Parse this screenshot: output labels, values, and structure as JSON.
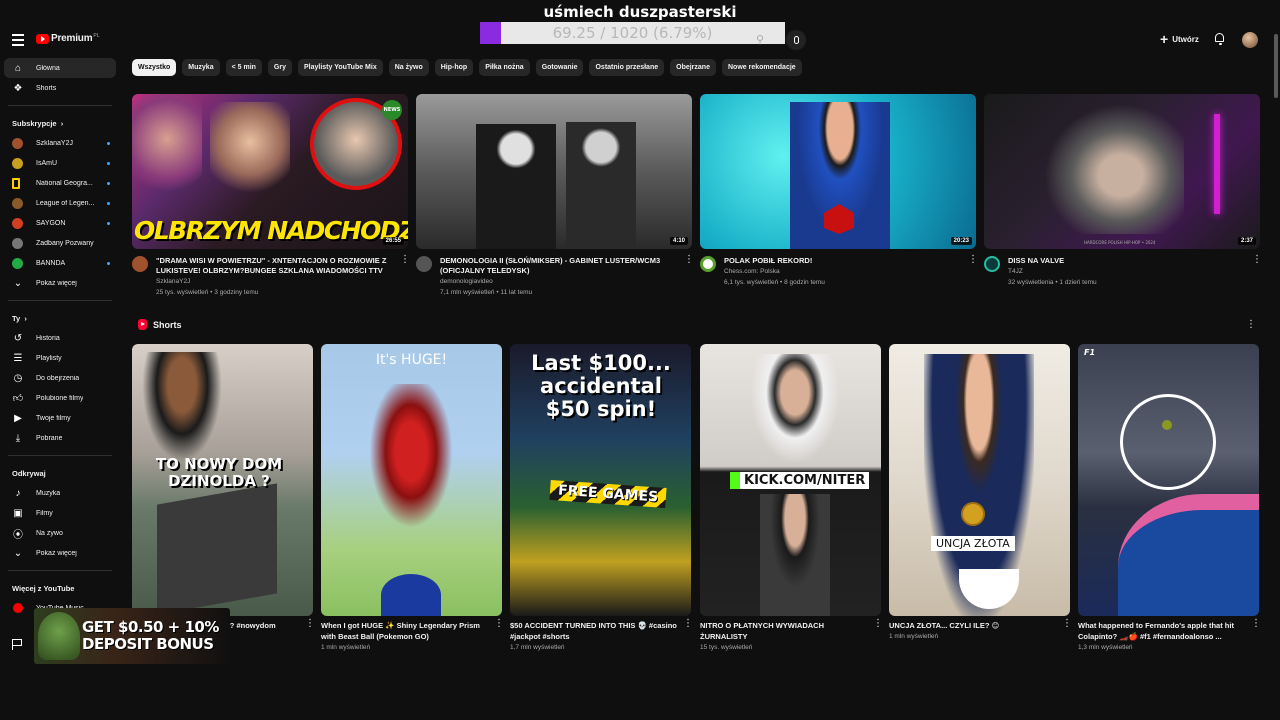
{
  "overlay": {
    "title": "uśmiech duszpasterski",
    "progress_text": "69.25 / 1020 (6.79%)",
    "progress_fraction": 0.0679
  },
  "header": {
    "logo": "Premium",
    "logo_region": "PL",
    "create": "Utwórz"
  },
  "sidebar": {
    "main": [
      {
        "label": "Główna",
        "icon": "home-icon",
        "active": true
      },
      {
        "label": "Shorts",
        "icon": "shorts-icon"
      }
    ],
    "subs_heading": "Subskrypcje",
    "subs": [
      {
        "label": "SzklanaY2J",
        "color": "#a0522d"
      },
      {
        "label": "IsAmU",
        "color": "#c8a020"
      },
      {
        "label": "National Geogra...",
        "color": "#ffcc00"
      },
      {
        "label": "League of Legen...",
        "color": "#8b5a2b"
      },
      {
        "label": "SAYGON",
        "color": "#d04020"
      },
      {
        "label": "Zadbany Pozwany",
        "color": "#777777"
      },
      {
        "label": "BANNDA",
        "color": "#22aa44"
      },
      {
        "label": "Pokaż więcej",
        "icon": "chevron-down-icon"
      }
    ],
    "you_heading": "Ty",
    "you": [
      {
        "label": "Historia",
        "icon": "history-icon"
      },
      {
        "label": "Playlisty",
        "icon": "playlists-icon"
      },
      {
        "label": "Do obejrzenia",
        "icon": "watch-later-icon"
      },
      {
        "label": "Polubione filmy",
        "icon": "like-icon"
      },
      {
        "label": "Twoje filmy",
        "icon": "your-videos-icon"
      },
      {
        "label": "Pobrane",
        "icon": "download-icon"
      }
    ],
    "explore_heading": "Odkrywaj",
    "explore": [
      {
        "label": "Muzyka",
        "icon": "music-icon"
      },
      {
        "label": "Filmy",
        "icon": "movies-icon"
      },
      {
        "label": "Na żywo",
        "icon": "live-icon"
      },
      {
        "label": "Pokaż więcej",
        "icon": "chevron-down-icon"
      }
    ],
    "more_heading": "Więcej z YouTube",
    "more": [
      {
        "label": "YouTube Music"
      }
    ]
  },
  "chips": [
    "Wszystko",
    "Muzyka",
    "< 5 min",
    "Gry",
    "Playlisty YouTube Mix",
    "Na żywo",
    "Hip-hop",
    "Piłka nożna",
    "Gotowanie",
    "Ostatnio przesłane",
    "Obejrzane",
    "Nowe rekomendacje"
  ],
  "videos": [
    {
      "title": "\"DRAMA WISI W POWIETRZU\" - XNTENTACJON O ROZMOWIE Z LUKISTEVE! OLBRZYM?BUNGEE SZKLANA WIADOMOŚCI TTV",
      "channel": "SzklanaY2J",
      "stats": "25 tys. wyświetleń • 3 godziny temu",
      "duration": "26:55",
      "overlay": "OLBRZYM NADCHODZI!?",
      "badge": "NEWS"
    },
    {
      "title": "DEMONOLOGIA II (SŁOŃ/MIKSER) - GABINET LUSTER/WCM3 (OFICJALNY TELEDYSK)",
      "channel": "demonologiavideo",
      "stats": "7,1 mln wyświetleń • 11 lat temu",
      "duration": "4:10"
    },
    {
      "title": "POLAK POBIŁ REKORD!",
      "channel": "Chess.com: Polska",
      "stats": "6,1 tys. wyświetleń • 8 godzin temu",
      "duration": "20:23"
    },
    {
      "title": "DISS NA VALVE",
      "channel": "T4JZ",
      "stats": "32 wyświetlenia • 1 dzień temu",
      "duration": "2:37",
      "corner": "HARDCORE POLISH HIP-HOP • 2024"
    }
  ],
  "shorts_heading": "Shorts",
  "shorts": [
    {
      "title": "TO NOWY DOM DZINOLDA ? #nowydom #dzinold",
      "views": "",
      "overlay": "TO NOWY DOM DZINOLDA ?"
    },
    {
      "title": "When I got HUGE ✨ Shiny Legendary Prism with Beast Ball (Pokemon GO)",
      "views": "1 mln wyświetleń",
      "overlay": "It's HUGE!"
    },
    {
      "title": "$50 ACCIDENT TURNED INTO THIS 💀 #casino #jackpot #shorts",
      "views": "1,7 mln wyświetleń",
      "overlay": "Last $100... accidental $50 spin!",
      "overlay2": "FREE GAMES"
    },
    {
      "title": "NITRO O PŁATNYCH WYWIADACH ŻURNALISTY",
      "views": "15 tys. wyświetleń",
      "overlay": "KICK.COM/NITER"
    },
    {
      "title": "UNCJA ZŁOTA... CZYLI ILE? 😊",
      "views": "1 mln wyświetleń",
      "overlay": "UNCJA ZŁOTA"
    },
    {
      "title": "What happened to Fernando's apple that hit Colapinto? 🏎️🍎 #f1 #fernandoalonso ...",
      "views": "1,3 mln wyświetleń",
      "overlay": "F1"
    }
  ],
  "ad": {
    "text": "GET $0.50 + 10% DEPOSIT BONUS"
  }
}
